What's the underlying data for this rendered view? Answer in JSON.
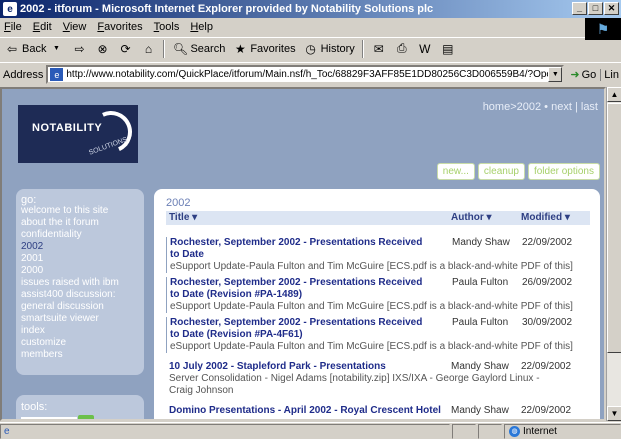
{
  "window": {
    "title": "2002 - itforum - Microsoft Internet Explorer provided by Notability Solutions plc"
  },
  "menu": [
    "File",
    "Edit",
    "View",
    "Favorites",
    "Tools",
    "Help"
  ],
  "toolbar": {
    "back": "Back",
    "search": "Search",
    "favorites": "Favorites",
    "history": "History"
  },
  "address": {
    "label": "Address",
    "url": "http://www.notability.com/QuickPlace/itforum/Main.nsf/h_Toc/68829F3AFF85E1DD80256C3D006559B4/?OpenDocumer",
    "go": "Go",
    "links": "Lin"
  },
  "logo": {
    "brand": "NOTABILITY",
    "sub": "SOLUTIONS"
  },
  "breadcrumb": {
    "home": "home",
    "current": ">2002",
    "sep1": " • ",
    "next": "next",
    "sep2": " | ",
    "last": "last"
  },
  "actions": [
    "new...",
    "cleanup",
    "folder options"
  ],
  "nav": {
    "go_label": "go:",
    "items": [
      "welcome to this site",
      "about the it forum",
      "confidentiality",
      "2002",
      "2001",
      "2000",
      "issues raised with ibm",
      "assist400 discussion:",
      "general discussion",
      "smartsuite viewer",
      "index",
      "customize",
      "members"
    ],
    "current_index": 3
  },
  "tools": {
    "label": "tools:"
  },
  "folder": {
    "name": "2002",
    "columns": {
      "title": "Title ▾",
      "author": "Author ▾",
      "modified": "Modified ▾"
    },
    "docs": [
      {
        "title": "Rochester, September 2002 - Presentations Received to Date",
        "author": "Mandy Shaw",
        "date": "22/09/2002",
        "desc": "eSupport Update-Paula Fulton and Tim McGuire [ECS.pdf is a black-and-white PDF of this]"
      },
      {
        "title": "Rochester, September 2002 - Presentations Received to Date (Revision #PA-1489)",
        "author": "Paula Fulton",
        "date": "26/09/2002",
        "desc": "eSupport Update-Paula Fulton and Tim McGuire [ECS.pdf is a black-and-white PDF of this]"
      },
      {
        "title": "Rochester, September 2002 - Presentations Received to Date (Revision #PA-4F61)",
        "author": "Paula Fulton",
        "date": "30/09/2002",
        "desc": "eSupport Update-Paula Fulton and Tim McGuire [ECS.pdf is a black-and-white PDF of this]"
      },
      {
        "title": "10 July 2002 - Stapleford Park - Presentations",
        "author": "Mandy Shaw",
        "date": "22/09/2002",
        "desc": "Server Consolidation - Nigel Adams [notability.zip] IXS/IXA - George Gaylord Linux - Craig Johnson"
      },
      {
        "title": "Domino Presentations - April 2002 - Royal Crescent Hotel",
        "author": "Mandy Shaw",
        "date": "22/09/2002",
        "desc": ""
      }
    ]
  },
  "status": {
    "text": "",
    "zone": "Internet"
  }
}
